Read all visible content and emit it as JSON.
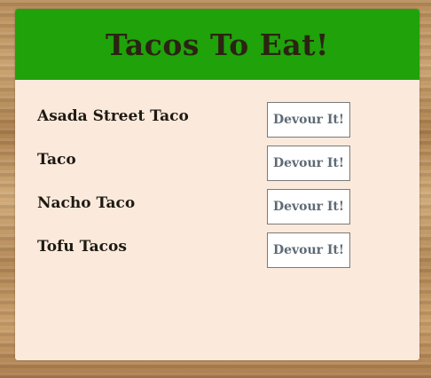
{
  "header": {
    "title": "Tacos To Eat!"
  },
  "colors": {
    "header_bg": "#1fa20a",
    "panel_bg": "#fbe9dc",
    "title_text": "#2b2412",
    "button_text": "#5e6a76"
  },
  "tacos": [
    {
      "name": "Asada Street Taco",
      "button_label": "Devour It!"
    },
    {
      "name": "Taco",
      "button_label": "Devour It!"
    },
    {
      "name": "Nacho Taco",
      "button_label": "Devour It!"
    },
    {
      "name": "Tofu Tacos",
      "button_label": "Devour It!"
    }
  ]
}
